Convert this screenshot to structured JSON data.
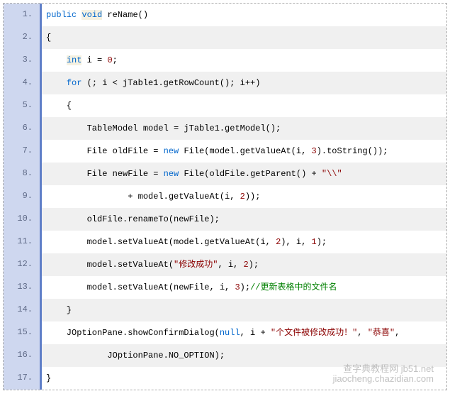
{
  "lines": [
    {
      "num": "1.",
      "tokens": [
        [
          "kw",
          "public"
        ],
        [
          "plain",
          " "
        ],
        [
          "bg-kw",
          "void"
        ],
        [
          "plain",
          " reName()"
        ]
      ]
    },
    {
      "num": "2.",
      "tokens": [
        [
          "plain",
          "{"
        ]
      ]
    },
    {
      "num": "3.",
      "tokens": [
        [
          "plain",
          "    "
        ],
        [
          "bg-kw",
          "int"
        ],
        [
          "plain",
          " i = "
        ],
        [
          "num",
          "0"
        ],
        [
          "plain",
          ";"
        ]
      ]
    },
    {
      "num": "4.",
      "tokens": [
        [
          "plain",
          "    "
        ],
        [
          "kw",
          "for"
        ],
        [
          "plain",
          " (; i < jTable1.getRowCount(); i++)"
        ]
      ]
    },
    {
      "num": "5.",
      "tokens": [
        [
          "plain",
          "    {"
        ]
      ]
    },
    {
      "num": "6.",
      "tokens": [
        [
          "plain",
          "        TableModel model = jTable1.getModel();"
        ]
      ]
    },
    {
      "num": "7.",
      "tokens": [
        [
          "plain",
          "        File oldFile = "
        ],
        [
          "kw",
          "new"
        ],
        [
          "plain",
          " File(model.getValueAt(i, "
        ],
        [
          "num",
          "3"
        ],
        [
          "plain",
          ").toString());"
        ]
      ]
    },
    {
      "num": "8.",
      "tokens": [
        [
          "plain",
          "        File newFile = "
        ],
        [
          "kw",
          "new"
        ],
        [
          "plain",
          " File(oldFile.getParent() + "
        ],
        [
          "str",
          "\"\\\\\""
        ]
      ]
    },
    {
      "num": "9.",
      "tokens": [
        [
          "plain",
          "                + model.getValueAt(i, "
        ],
        [
          "num",
          "2"
        ],
        [
          "plain",
          "));"
        ]
      ]
    },
    {
      "num": "10.",
      "tokens": [
        [
          "plain",
          "        oldFile.renameTo(newFile);"
        ]
      ]
    },
    {
      "num": "11.",
      "tokens": [
        [
          "plain",
          "        model.setValueAt(model.getValueAt(i, "
        ],
        [
          "num",
          "2"
        ],
        [
          "plain",
          "), i, "
        ],
        [
          "num",
          "1"
        ],
        [
          "plain",
          ");"
        ]
      ]
    },
    {
      "num": "12.",
      "tokens": [
        [
          "plain",
          "        model.setValueAt("
        ],
        [
          "str",
          "\"修改成功\""
        ],
        [
          "plain",
          ", i, "
        ],
        [
          "num",
          "2"
        ],
        [
          "plain",
          ");"
        ]
      ]
    },
    {
      "num": "13.",
      "tokens": [
        [
          "plain",
          "        model.setValueAt(newFile, i, "
        ],
        [
          "num",
          "3"
        ],
        [
          "plain",
          ");"
        ],
        [
          "cmt",
          "//更新表格中的文件名"
        ]
      ]
    },
    {
      "num": "14.",
      "tokens": [
        [
          "plain",
          "    }"
        ]
      ]
    },
    {
      "num": "15.",
      "tokens": [
        [
          "plain",
          "    JOptionPane.showConfirmDialog("
        ],
        [
          "kw",
          "null"
        ],
        [
          "plain",
          ", i + "
        ],
        [
          "str",
          "\"个文件被修改成功！\""
        ],
        [
          "plain",
          ", "
        ],
        [
          "str",
          "\"恭喜\""
        ],
        [
          "plain",
          ","
        ]
      ]
    },
    {
      "num": "16.",
      "tokens": [
        [
          "plain",
          "            JOptionPane.NO_OPTION);"
        ]
      ]
    },
    {
      "num": "17.",
      "tokens": [
        [
          "plain",
          "}"
        ]
      ]
    }
  ],
  "watermark": {
    "line1": "查字典教程网 jb51.net",
    "line2": "jiaocheng.chazidian.com"
  }
}
